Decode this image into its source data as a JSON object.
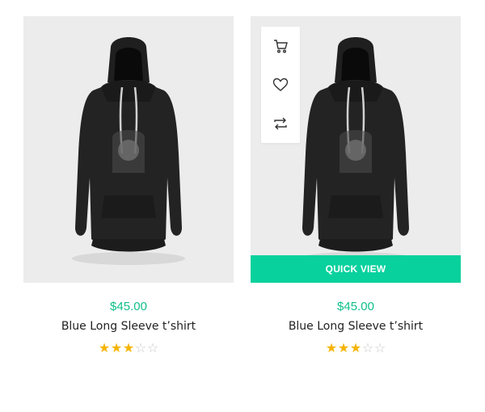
{
  "products": [
    {
      "price": "$45.00",
      "title": "Blue Long Sleeve t’shirt",
      "rating": 3,
      "rating_max": 5,
      "image": "black-hoodie-image"
    },
    {
      "price": "$45.00",
      "title": "Blue Long Sleeve t’shirt",
      "rating": 3,
      "rating_max": 5,
      "image": "black-hoodie-image",
      "actions": [
        "cart-icon",
        "heart-icon",
        "compare-icon"
      ],
      "quick_view_label": "QUICK VIEW"
    }
  ],
  "colors": {
    "accent": "#08d19d",
    "price": "#0fbf8a",
    "star": "#f6b401",
    "image_bg": "#ececec"
  }
}
